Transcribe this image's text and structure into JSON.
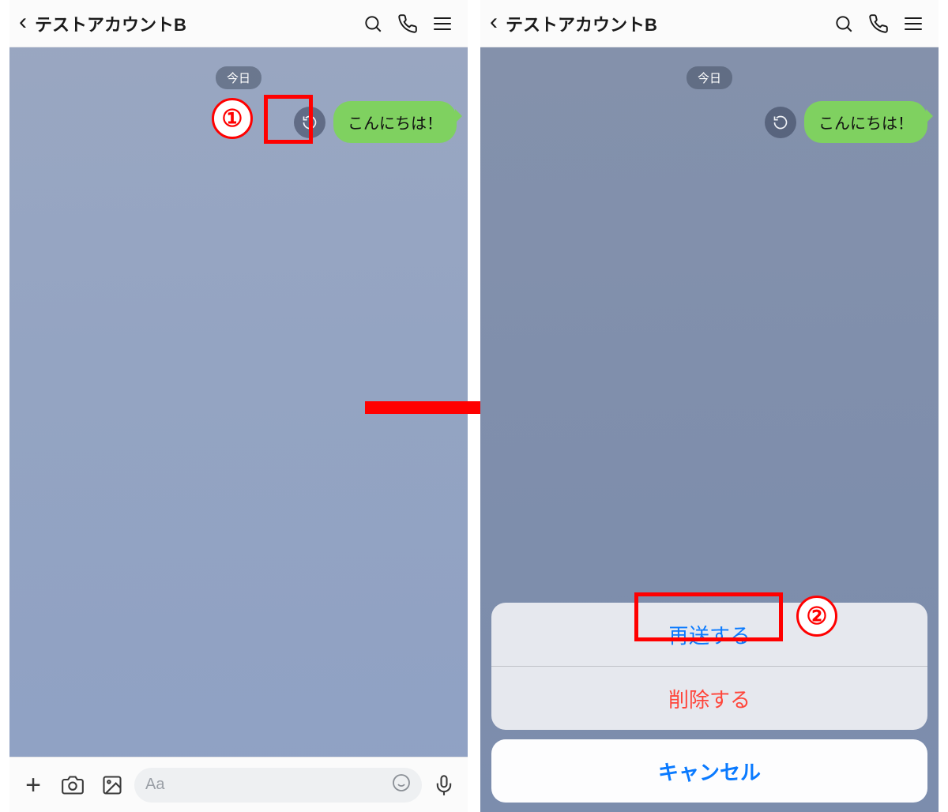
{
  "header": {
    "title": "テストアカウントB"
  },
  "chat": {
    "date_label": "今日",
    "message_text": "こんにちは！"
  },
  "input": {
    "placeholder": "Aa"
  },
  "action_sheet": {
    "resend": "再送する",
    "delete": "削除する",
    "cancel": "キャンセル"
  },
  "callouts": {
    "step1": "①",
    "step2": "②"
  },
  "icons": {
    "back": "chevron-left",
    "search": "search",
    "call": "phone",
    "menu": "hamburger",
    "retry": "refresh",
    "plus": "plus",
    "camera": "camera",
    "gallery": "image",
    "emoji": "smiley",
    "mic": "microphone"
  },
  "colors": {
    "accent_red": "#ff0000",
    "bubble_green": "#7fd160",
    "ios_blue": "#0a7aff",
    "ios_destructive": "#ff453a"
  }
}
